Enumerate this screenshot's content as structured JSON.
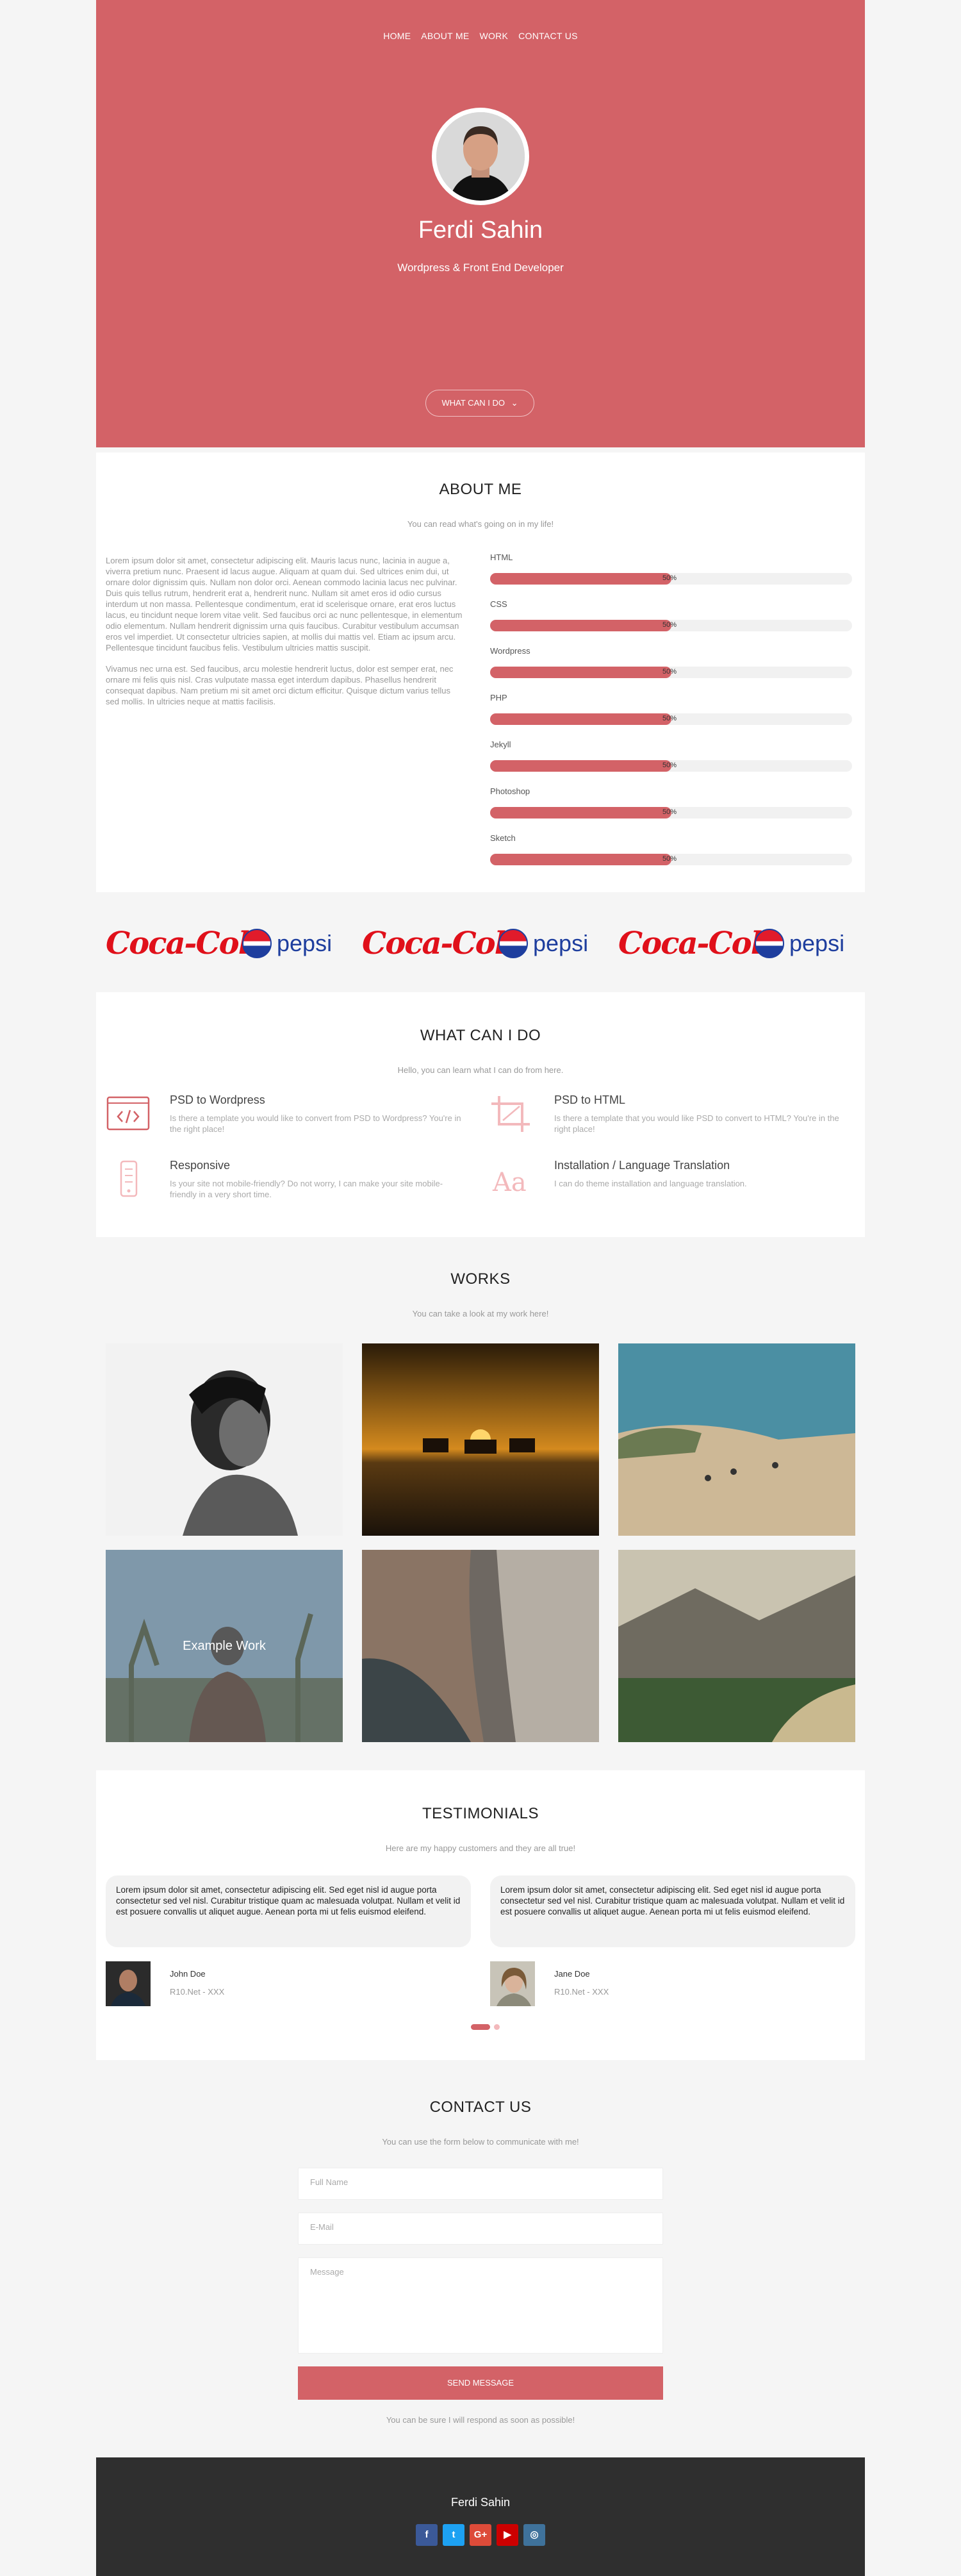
{
  "nav": {
    "items": [
      "HOME",
      "ABOUT ME",
      "WORK",
      "CONTACT US"
    ]
  },
  "hero": {
    "name": "Ferdi Sahin",
    "role": "Wordpress & Front End Developer",
    "cta": "WHAT CAN I DO"
  },
  "about": {
    "title": "ABOUT ME",
    "subtitle": "You can read what's going on in my life!",
    "paragraphs": [
      "Lorem ipsum dolor sit amet, consectetur adipiscing elit. Mauris lacus nunc, lacinia in augue a, viverra pretium nunc. Praesent id lacus augue. Aliquam at quam dui. Sed ultrices enim dui, ut ornare dolor dignissim quis. Nullam non dolor orci. Aenean commodo lacinia lacus nec pulvinar. Duis quis tellus rutrum, hendrerit erat a, hendrerit nunc. Nullam sit amet eros id odio cursus interdum ut non massa. Pellentesque condimentum, erat id scelerisque ornare, erat eros luctus lacus, eu tincidunt neque lorem vitae velit. Sed faucibus orci ac nunc pellentesque, in elementum odio elementum. Nullam hendrerit dignissim urna quis faucibus. Curabitur vestibulum accumsan eros vel imperdiet. Ut consectetur ultricies sapien, at mollis dui mattis vel. Etiam ac ipsum arcu. Pellentesque tincidunt faucibus felis. Vestibulum ultricies mattis suscipit.",
      "Vivamus nec urna est. Sed faucibus, arcu molestie hendrerit luctus, dolor est semper erat, nec ornare mi felis quis nisl. Cras vulputate massa eget interdum dapibus. Phasellus hendrerit consequat dapibus. Nam pretium mi sit amet orci dictum efficitur. Quisque dictum varius tellus sed mollis. In ultricies neque at mattis facilisis."
    ],
    "skills": [
      {
        "name": "HTML",
        "percent": 50,
        "label": "50%"
      },
      {
        "name": "CSS",
        "percent": 50,
        "label": "50%"
      },
      {
        "name": "Wordpress",
        "percent": 50,
        "label": "50%"
      },
      {
        "name": "PHP",
        "percent": 50,
        "label": "50%"
      },
      {
        "name": "Jekyll",
        "percent": 50,
        "label": "50%"
      },
      {
        "name": "Photoshop",
        "percent": 50,
        "label": "50%"
      },
      {
        "name": "Sketch",
        "percent": 50,
        "label": "50%"
      }
    ]
  },
  "brands": {
    "logos": [
      "Coca-Cola",
      "pepsi",
      "Coca-Cola",
      "pepsi",
      "Coca-Cola",
      "pepsi"
    ]
  },
  "services": {
    "title": "WHAT CAN I DO",
    "subtitle": "Hello, you can learn what I can do from here.",
    "items": [
      {
        "icon": "code-icon",
        "title": "PSD to Wordpress",
        "desc": "Is there a template you would like to convert from PSD to Wordpress? You're in the right place!"
      },
      {
        "icon": "crop-icon",
        "title": "PSD to HTML",
        "desc": "Is there a template that you would like PSD to convert to HTML? You're in the right place!"
      },
      {
        "icon": "mobile-icon",
        "title": "Responsive",
        "desc": "Is your site not mobile-friendly? Do not worry, I can make your site mobile-friendly in a very short time."
      },
      {
        "icon": "translate-icon",
        "title": "Installation / Language Translation",
        "desc": "I can do theme installation and language translation."
      }
    ]
  },
  "works": {
    "title": "WORKS",
    "subtitle": "You can take a look at my work here!",
    "overlay": "Example Work"
  },
  "testimonials": {
    "title": "TESTIMONIALS",
    "subtitle": "Here are my happy customers and they are all true!",
    "items": [
      {
        "text": "Lorem ipsum dolor sit amet, consectetur adipiscing elit. Sed eget nisl id augue porta consectetur sed vel nisl. Curabitur tristique quam ac malesuada volutpat. Nullam et velit id est posuere convallis ut aliquet augue. Aenean porta mi ut felis euismod eleifend.",
        "name": "John Doe",
        "company": "R10.Net - XXX"
      },
      {
        "text": "Lorem ipsum dolor sit amet, consectetur adipiscing elit. Sed eget nisl id augue porta consectetur sed vel nisl. Curabitur tristique quam ac malesuada volutpat. Nullam et velit id est posuere convallis ut aliquet augue. Aenean porta mi ut felis euismod eleifend.",
        "name": "Jane Doe",
        "company": "R10.Net - XXX"
      }
    ]
  },
  "contact": {
    "title": "CONTACT US",
    "subtitle": "You can use the form below to communicate with me!",
    "name_placeholder": "Full Name",
    "email_placeholder": "E-Mail",
    "message_placeholder": "Message",
    "send": "SEND MESSAGE",
    "note": "You can be sure I will respond as soon as possible!"
  },
  "footer": {
    "name": "Ferdi Sahin",
    "social": [
      {
        "icon": "facebook-icon",
        "glyph": "f",
        "color": "#3b5998"
      },
      {
        "icon": "twitter-icon",
        "glyph": "t",
        "color": "#1da1f2"
      },
      {
        "icon": "google-plus-icon",
        "glyph": "G+",
        "color": "#dd4b39"
      },
      {
        "icon": "youtube-icon",
        "glyph": "▶",
        "color": "#cc0000"
      },
      {
        "icon": "instagram-icon",
        "glyph": "◎",
        "color": "#3f729b"
      }
    ]
  },
  "colors": {
    "accent": "#d36267",
    "footer": "#2f2f2f"
  }
}
